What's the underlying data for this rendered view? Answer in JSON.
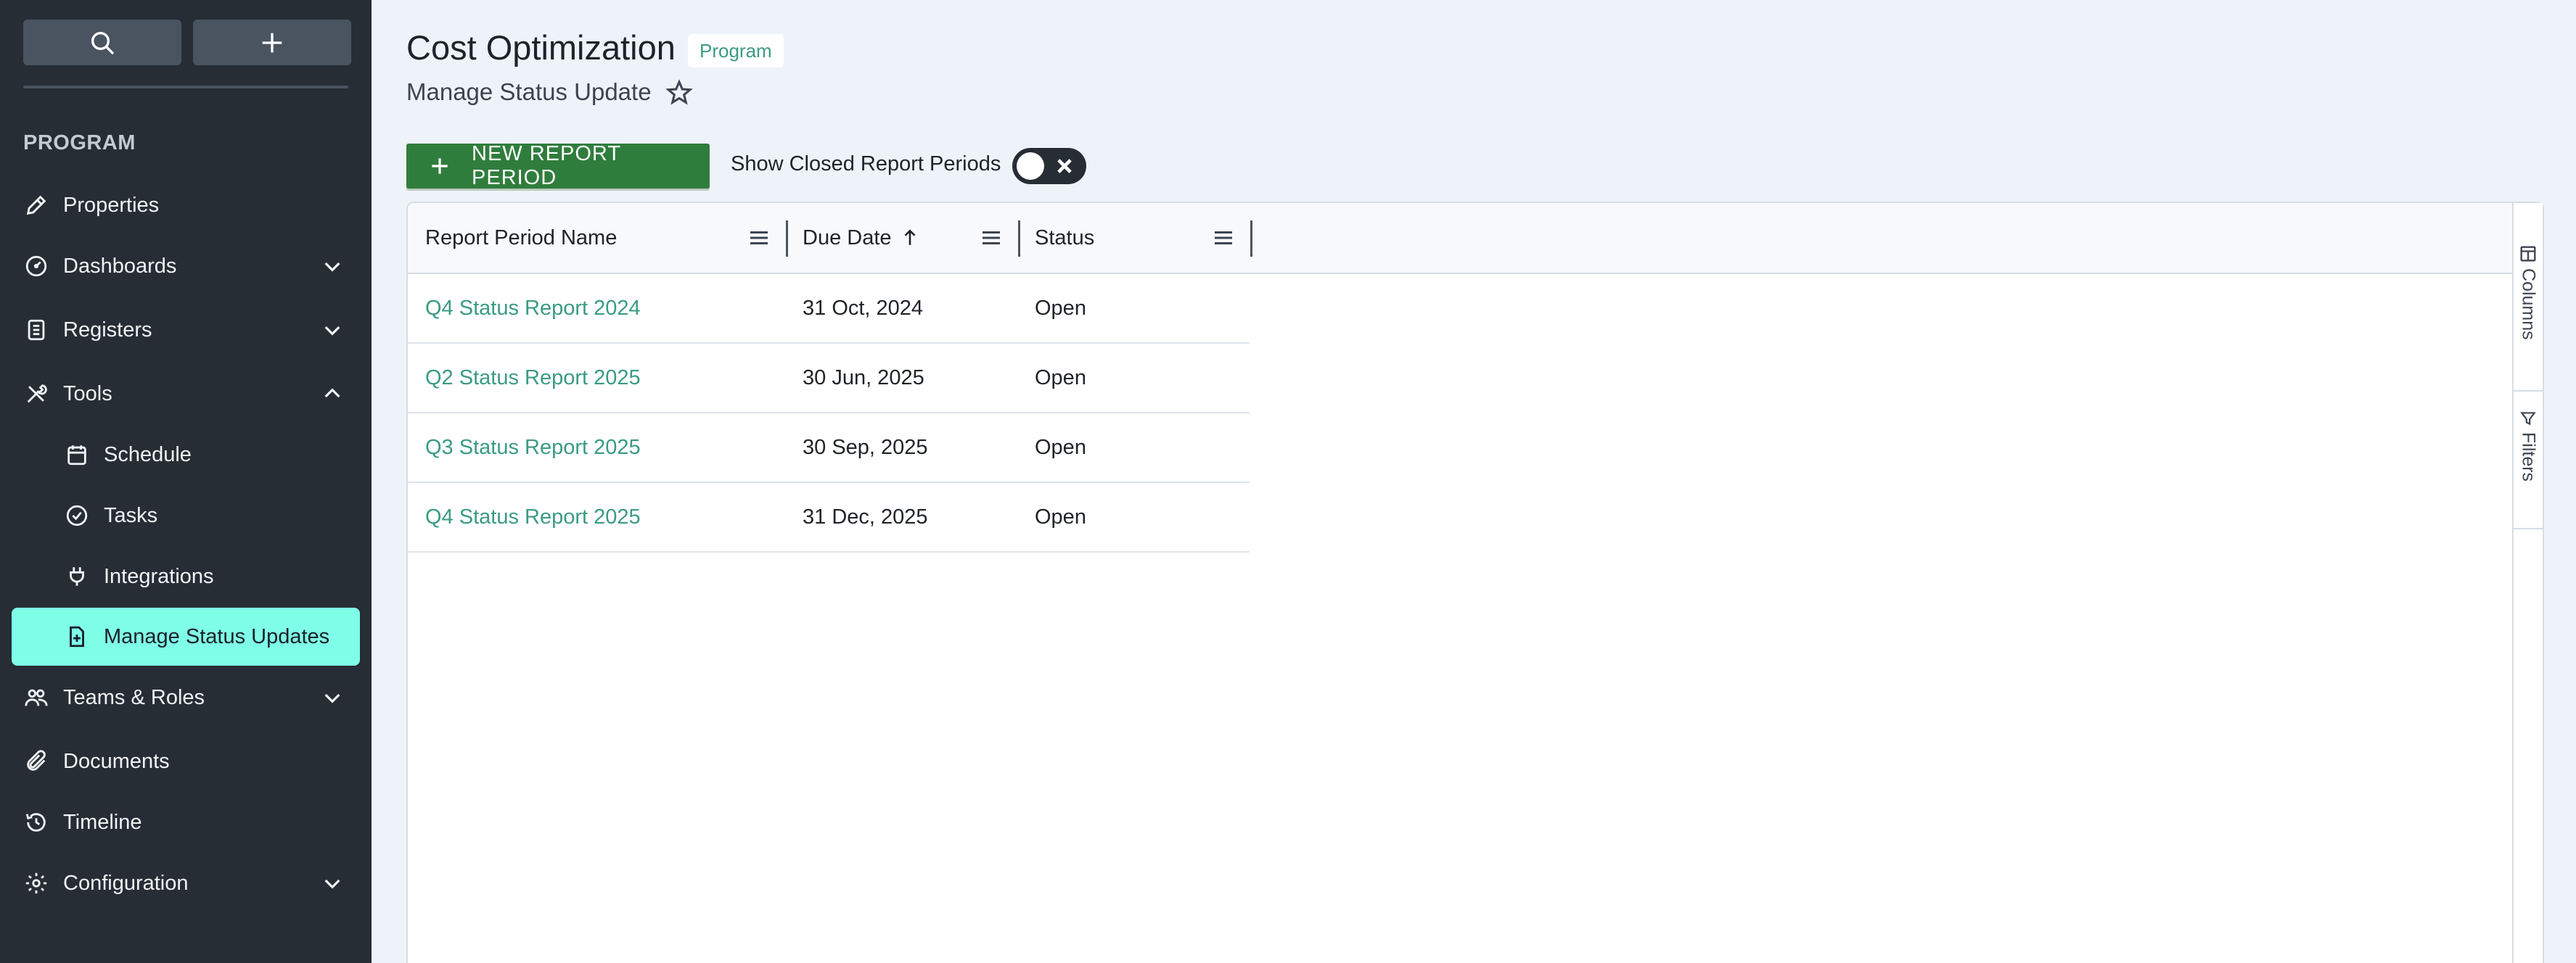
{
  "sidebar": {
    "section_label": "PROGRAM",
    "items": [
      {
        "label": "Properties"
      },
      {
        "label": "Dashboards"
      },
      {
        "label": "Registers"
      },
      {
        "label": "Tools"
      },
      {
        "label": "Schedule"
      },
      {
        "label": "Tasks"
      },
      {
        "label": "Integrations"
      },
      {
        "label": "Manage Status Updates"
      },
      {
        "label": "Teams & Roles"
      },
      {
        "label": "Documents"
      },
      {
        "label": "Timeline"
      },
      {
        "label": "Configuration"
      }
    ],
    "active_item": "Manage Status Updates"
  },
  "header": {
    "title": "Cost Optimization",
    "badge": "Program",
    "subtitle": "Manage Status Update"
  },
  "toolbar": {
    "new_button_label": "NEW REPORT PERIOD",
    "toggle_label": "Show Closed Report Periods",
    "toggle_on": false
  },
  "grid": {
    "columns": [
      {
        "label": "Report Period Name"
      },
      {
        "label": "Due Date",
        "sort": "ascending"
      },
      {
        "label": "Status"
      }
    ],
    "rows": [
      {
        "name": "Q4 Status Report 2024",
        "due": "31 Oct, 2024",
        "status": "Open"
      },
      {
        "name": "Q2 Status Report 2025",
        "due": "30 Jun, 2025",
        "status": "Open"
      },
      {
        "name": "Q3 Status Report 2025",
        "due": "30 Sep, 2025",
        "status": "Open"
      },
      {
        "name": "Q4 Status Report 2025",
        "due": "31 Dec, 2025",
        "status": "Open"
      }
    ],
    "side_tabs": {
      "columns": "Columns",
      "filters": "Filters"
    }
  },
  "colors": {
    "sidebar_bg": "#262d35",
    "active_item": "#7fffe8",
    "primary_button": "#2f7d3c",
    "link": "#3a9b82",
    "page_bg": "#eef3fa"
  }
}
